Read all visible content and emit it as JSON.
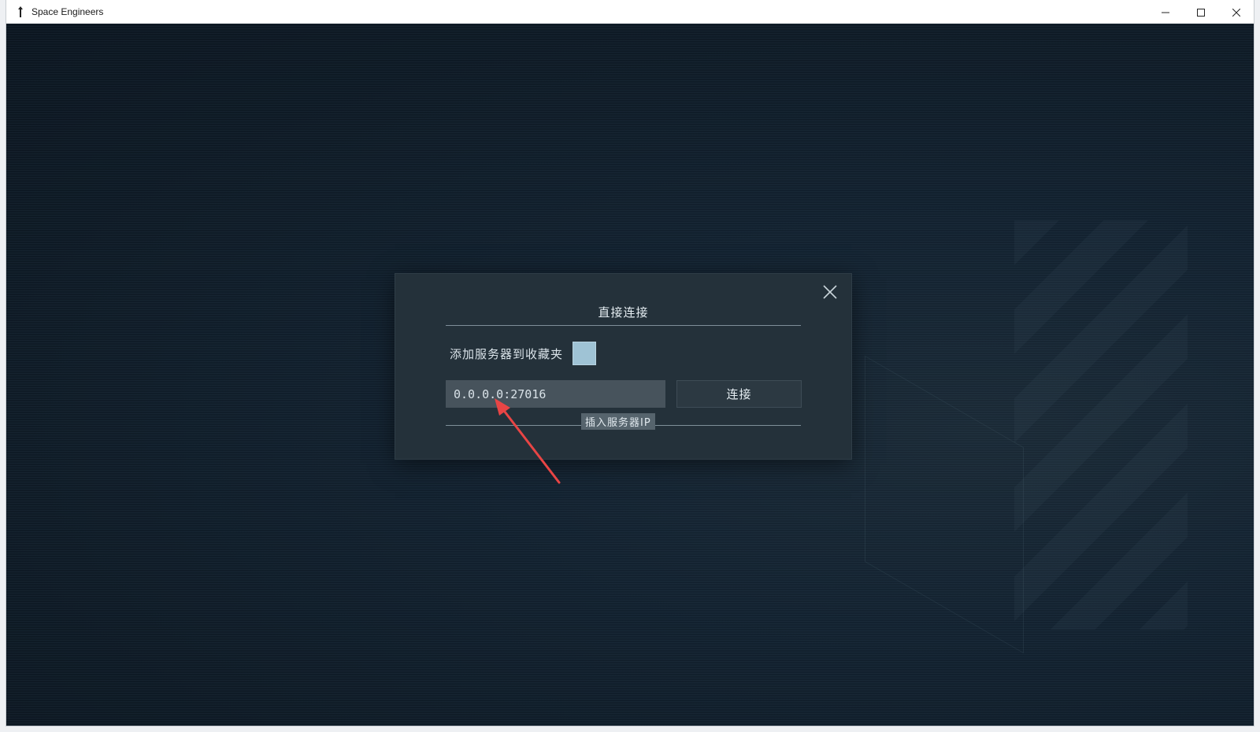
{
  "window": {
    "title": "Space Engineers",
    "controls": {
      "minimize": "minimize-icon",
      "maximize": "maximize-icon",
      "close": "close-icon"
    }
  },
  "dialog": {
    "title": "直接连接",
    "favorite_label": "添加服务器到收藏夹",
    "ip_value": "0.0.0.0:27016",
    "connect_label": "连接",
    "tooltip": "插入服务器IP"
  },
  "colors": {
    "background": "#0f1a24",
    "dialog": "#24313a",
    "checkbox": "#9fc3d5",
    "annotation_arrow": "#e84545"
  }
}
